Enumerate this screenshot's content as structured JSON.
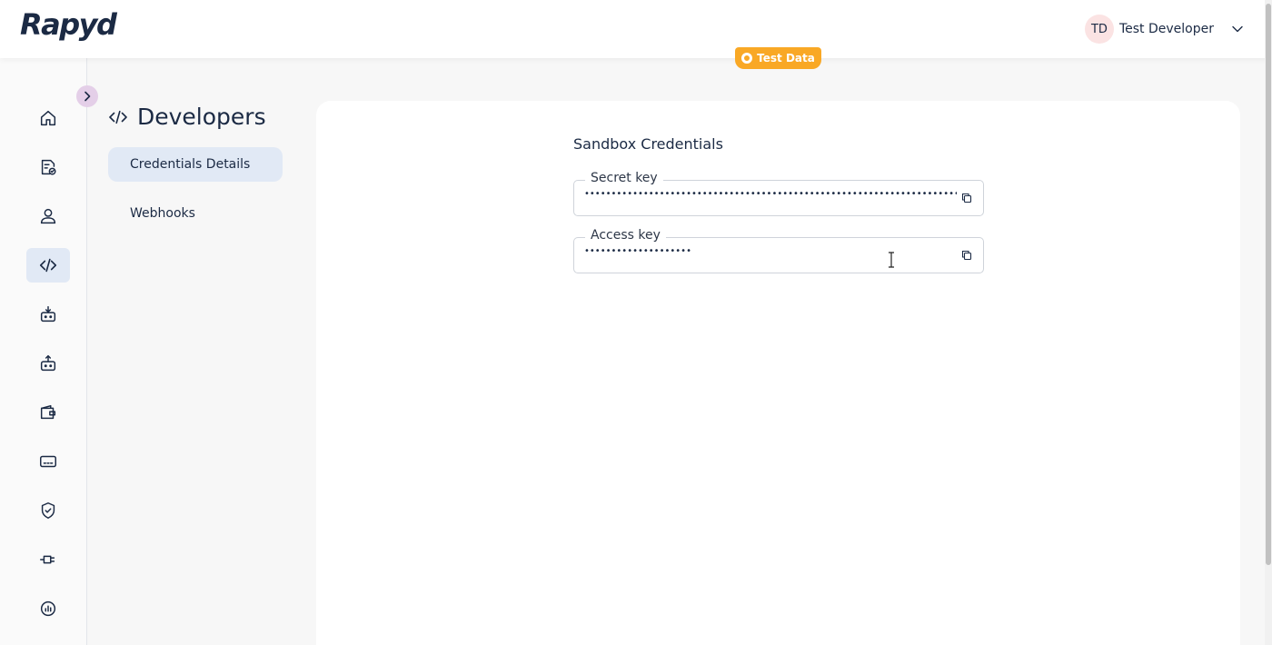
{
  "brand": {
    "logo_text": "Rapyd"
  },
  "user": {
    "initials": "TD",
    "name": "Test Developer"
  },
  "badge": {
    "label": "Test Data"
  },
  "rail": {
    "items": [
      {
        "icon": "home-icon"
      },
      {
        "icon": "document-check-icon"
      },
      {
        "icon": "user-icon"
      },
      {
        "icon": "code-icon",
        "active": true
      },
      {
        "icon": "collect-icon"
      },
      {
        "icon": "disburse-icon"
      },
      {
        "icon": "wallet-icon"
      },
      {
        "icon": "card-icon"
      },
      {
        "icon": "shield-check-icon"
      },
      {
        "icon": "plug-icon"
      },
      {
        "icon": "report-icon"
      }
    ]
  },
  "subnav": {
    "title": "Developers",
    "items": [
      {
        "label": "Credentials Details",
        "active": true
      },
      {
        "label": "Webhooks",
        "active": false
      }
    ]
  },
  "credentials": {
    "section_title": "Sandbox Credentials",
    "secret_key": {
      "label": "Secret key",
      "value": "••••••••••••••••••••••••••••••••••••••••••••••••••••••••••••••••••••••"
    },
    "access_key": {
      "label": "Access key",
      "value": "••••••••••••••••••••"
    }
  },
  "colors": {
    "accent": "#f9a825",
    "navy": "#1b2a44",
    "active_bg": "#e1e9f5"
  }
}
